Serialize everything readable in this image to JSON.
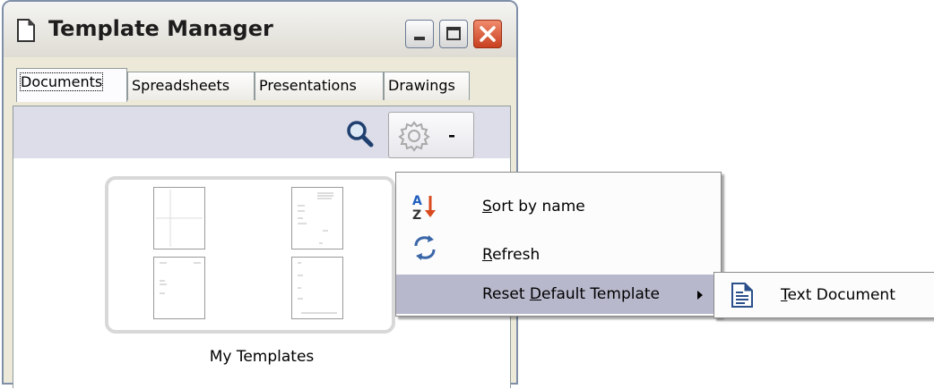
{
  "window": {
    "title": "Template Manager",
    "title_icon": "document-icon",
    "controls": [
      "minimize-icon",
      "maximize-icon",
      "close-icon"
    ],
    "close_color": "#d9532e"
  },
  "tabs": [
    {
      "label": "Documents",
      "active": true
    },
    {
      "label": "Spreadsheets",
      "active": false
    },
    {
      "label": "Presentations",
      "active": false
    },
    {
      "label": "Drawings",
      "active": false
    }
  ],
  "toolbar": {
    "search_icon": "search-icon",
    "action_icon": "gear-icon",
    "dropdown_icon": "caret-down-icon"
  },
  "folders": [
    {
      "name": "My Templates"
    }
  ],
  "context_menu": {
    "items": [
      {
        "icon": "sort-az-icon",
        "mnemonic": "S",
        "rest": "ort by name"
      },
      {
        "icon": "refresh-icon",
        "mnemonic": "R",
        "rest": "efresh"
      },
      {
        "icon": "",
        "pre": "Reset ",
        "mnemonic": "D",
        "rest": "efault Template",
        "highlighted": true,
        "has_submenu": true
      }
    ]
  },
  "submenu": {
    "items": [
      {
        "icon": "text-document-icon",
        "mnemonic": "T",
        "rest": "ext Document"
      }
    ]
  },
  "colors": {
    "highlight": "#b8b8cc",
    "toolbar_bg": "#dcdde8",
    "frame": "#7f8fa8"
  }
}
